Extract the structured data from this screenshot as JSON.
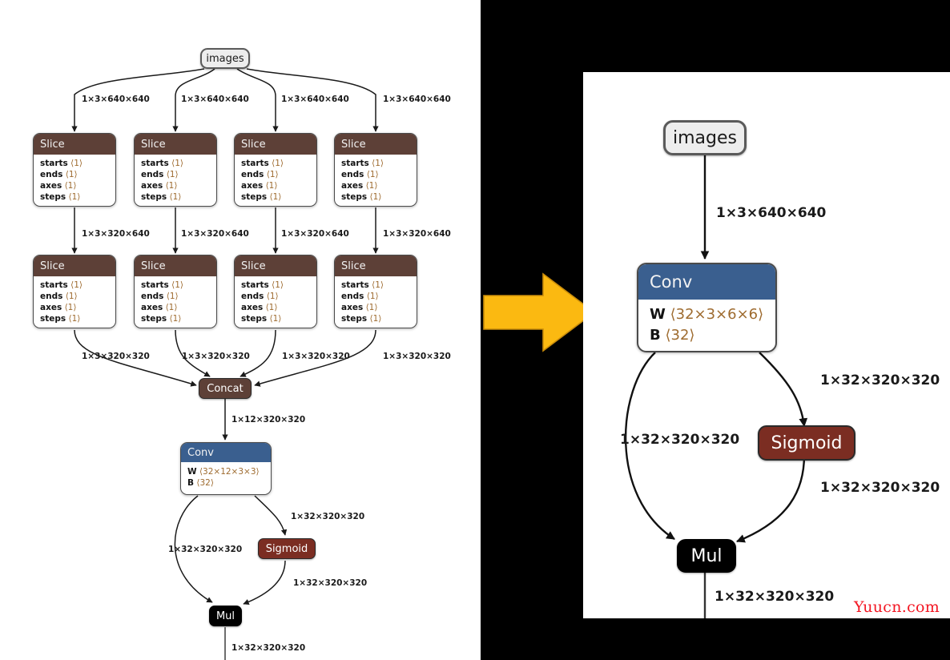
{
  "figure": {
    "left_panel": {
      "title": "onnx-graph-before",
      "nodes": {
        "images": {
          "label": "images",
          "type": "io"
        },
        "slice_row1": [
          {
            "label": "Slice",
            "attrs": [
              {
                "key": "starts",
                "value": "⟨1⟩"
              },
              {
                "key": "ends",
                "value": "⟨1⟩"
              },
              {
                "key": "axes",
                "value": "⟨1⟩"
              },
              {
                "key": "steps",
                "value": "⟨1⟩"
              }
            ]
          },
          {
            "label": "Slice",
            "attrs": [
              {
                "key": "starts",
                "value": "⟨1⟩"
              },
              {
                "key": "ends",
                "value": "⟨1⟩"
              },
              {
                "key": "axes",
                "value": "⟨1⟩"
              },
              {
                "key": "steps",
                "value": "⟨1⟩"
              }
            ]
          },
          {
            "label": "Slice",
            "attrs": [
              {
                "key": "starts",
                "value": "⟨1⟩"
              },
              {
                "key": "ends",
                "value": "⟨1⟩"
              },
              {
                "key": "axes",
                "value": "⟨1⟩"
              },
              {
                "key": "steps",
                "value": "⟨1⟩"
              }
            ]
          },
          {
            "label": "Slice",
            "attrs": [
              {
                "key": "starts",
                "value": "⟨1⟩"
              },
              {
                "key": "ends",
                "value": "⟨1⟩"
              },
              {
                "key": "axes",
                "value": "⟨1⟩"
              },
              {
                "key": "steps",
                "value": "⟨1⟩"
              }
            ]
          }
        ],
        "slice_row2": [
          {
            "label": "Slice",
            "attrs": [
              {
                "key": "starts",
                "value": "⟨1⟩"
              },
              {
                "key": "ends",
                "value": "⟨1⟩"
              },
              {
                "key": "axes",
                "value": "⟨1⟩"
              },
              {
                "key": "steps",
                "value": "⟨1⟩"
              }
            ]
          },
          {
            "label": "Slice",
            "attrs": [
              {
                "key": "starts",
                "value": "⟨1⟩"
              },
              {
                "key": "ends",
                "value": "⟨1⟩"
              },
              {
                "key": "axes",
                "value": "⟨1⟩"
              },
              {
                "key": "steps",
                "value": "⟨1⟩"
              }
            ]
          },
          {
            "label": "Slice",
            "attrs": [
              {
                "key": "starts",
                "value": "⟨1⟩"
              },
              {
                "key": "ends",
                "value": "⟨1⟩"
              },
              {
                "key": "axes",
                "value": "⟨1⟩"
              },
              {
                "key": "steps",
                "value": "⟨1⟩"
              }
            ]
          },
          {
            "label": "Slice",
            "attrs": [
              {
                "key": "starts",
                "value": "⟨1⟩"
              },
              {
                "key": "ends",
                "value": "⟨1⟩"
              },
              {
                "key": "axes",
                "value": "⟨1⟩"
              },
              {
                "key": "steps",
                "value": "⟨1⟩"
              }
            ]
          }
        ],
        "concat": {
          "label": "Concat",
          "type": "op"
        },
        "conv": {
          "label": "Conv",
          "attrs": [
            {
              "key": "W",
              "value": "⟨32×12×3×3⟩"
            },
            {
              "key": "B",
              "value": "⟨32⟩"
            }
          ]
        },
        "sigmoid": {
          "label": "Sigmoid",
          "type": "op"
        },
        "mul": {
          "label": "Mul",
          "type": "op"
        }
      },
      "edge_labels": {
        "images_to_slice": [
          "1×3×640×640",
          "1×3×640×640",
          "1×3×640×640",
          "1×3×640×640"
        ],
        "slice1_to_slice2": [
          "1×3×320×640",
          "1×3×320×640",
          "1×3×320×640",
          "1×3×320×640"
        ],
        "slice2_to_concat": [
          "1×3×320×320",
          "1×3×320×320",
          "1×3×320×320",
          "1×3×320×320"
        ],
        "concat_to_conv": "1×12×320×320",
        "conv_to_sigmoid": "1×32×320×320",
        "conv_to_mul": "1×32×320×320",
        "sigmoid_to_mul": "1×32×320×320",
        "mul_out": "1×32×320×320"
      }
    },
    "transform_arrow": {
      "label": "transform-arrow",
      "color": "#FBB911"
    },
    "right_panel": {
      "title": "onnx-graph-after",
      "nodes": {
        "images": {
          "label": "images",
          "type": "io"
        },
        "conv": {
          "label": "Conv",
          "attrs": [
            {
              "key": "W",
              "value": "⟨32×3×6×6⟩"
            },
            {
              "key": "B",
              "value": "⟨32⟩"
            }
          ]
        },
        "sigmoid": {
          "label": "Sigmoid",
          "type": "op"
        },
        "mul": {
          "label": "Mul",
          "type": "op"
        }
      },
      "edge_labels": {
        "images_to_conv": "1×3×640×640",
        "conv_to_sigmoid": "1×32×320×320",
        "conv_to_mul": "1×32×320×320",
        "sigmoid_to_mul": "1×32×320×320",
        "mul_out": "1×32×320×320"
      }
    },
    "watermark": "Yuucn.com",
    "colors": {
      "slice_header": "#5D4037",
      "conv_header": "#3A5F8F",
      "sigmoid": "#7B2D22",
      "mul": "#000000",
      "io_node": "#EDEDED",
      "arrow_yellow": "#FBB911",
      "watermark": "#F31622",
      "attr_value": "#9E6B2F"
    }
  }
}
